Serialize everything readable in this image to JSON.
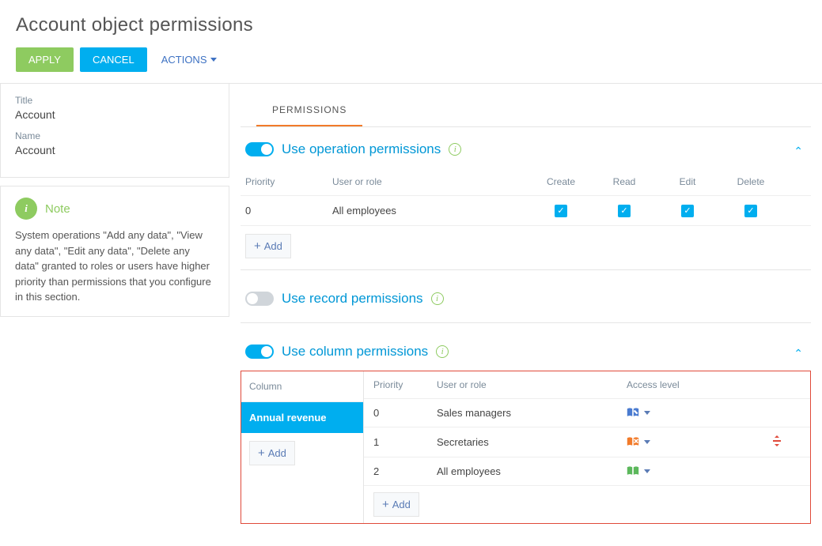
{
  "page": {
    "title": "Account object permissions",
    "apply": "APPLY",
    "cancel": "CANCEL",
    "actions": "ACTIONS"
  },
  "sidebar": {
    "title_label": "Title",
    "title_value": "Account",
    "name_label": "Name",
    "name_value": "Account",
    "note_label": "Note",
    "note_icon": "i",
    "note_body": "System operations \"Add any data\", \"View any data\", \"Edit any data\", \"Delete any data\" granted to roles or users have higher priority than permissions that you configure in this section."
  },
  "tabs": {
    "permissions": "PERMISSIONS"
  },
  "sections": {
    "operation": {
      "title": "Use operation permissions",
      "enabled": true,
      "cols": {
        "priority": "Priority",
        "user": "User or role",
        "create": "Create",
        "read": "Read",
        "edit": "Edit",
        "delete": "Delete"
      },
      "rows": [
        {
          "priority": "0",
          "user": "All employees",
          "create": true,
          "read": true,
          "edit": true,
          "delete": true
        }
      ],
      "add": "Add"
    },
    "record": {
      "title": "Use record permissions",
      "enabled": false
    },
    "column": {
      "title": "Use column permissions",
      "enabled": true,
      "left_head": "Column",
      "columns": [
        "Annual revenue"
      ],
      "add_left": "Add",
      "right_cols": {
        "priority": "Priority",
        "user": "User or role",
        "access": "Access level"
      },
      "rows": [
        {
          "priority": "0",
          "user": "Sales managers",
          "access": "edit"
        },
        {
          "priority": "1",
          "user": "Secretaries",
          "access": "deny"
        },
        {
          "priority": "2",
          "user": "All employees",
          "access": "read"
        }
      ],
      "add_right": "Add"
    }
  }
}
